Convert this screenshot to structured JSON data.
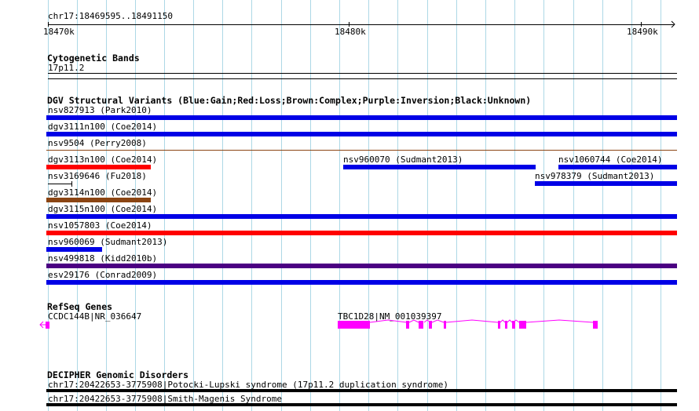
{
  "ruler": {
    "location": "chr17:18469595..18491150",
    "ticks": [
      "18470k",
      "18480k",
      "18490k"
    ]
  },
  "tracks": {
    "cytogenetic": {
      "title": "Cytogenetic Bands",
      "band_label": "17p11.2"
    },
    "dgv": {
      "title": "DGV Structural Variants (Blue:Gain;Red:Loss;Brown:Complex;Purple:Inversion;Black:Unknown)",
      "colors": {
        "gain": "#0000e6",
        "loss": "#ff0000",
        "complex": "#8b4513",
        "inversion": "#4b0082",
        "unknown": "#000000"
      },
      "features": [
        {
          "label": "nsv827913 (Park2010)",
          "type": "gain"
        },
        {
          "label": "dgv3111n100 (Coe2014)",
          "type": "gain"
        },
        {
          "label": "nsv9504 (Perry2008)",
          "type": "complex"
        },
        {
          "label": "dgv3113n100 (Coe2014)",
          "type": "loss"
        },
        {
          "label": "nsv960070 (Sudmant2013)",
          "type": "gain"
        },
        {
          "label": "nsv1060744 (Coe2014)",
          "type": "gain"
        },
        {
          "label": "nsv3169646 (Fu2018)",
          "type": "unknown"
        },
        {
          "label": "nsv978379 (Sudmant2013)",
          "type": "gain"
        },
        {
          "label": "dgv3114n100 (Coe2014)",
          "type": "complex"
        },
        {
          "label": "dgv3115n100 (Coe2014)",
          "type": "gain"
        },
        {
          "label": "nsv1057803 (Coe2014)",
          "type": "loss"
        },
        {
          "label": "nsv960069 (Sudmant2013)",
          "type": "gain"
        },
        {
          "label": "nsv499818 (Kidd2010b)",
          "type": "inversion"
        },
        {
          "label": "esv29176 (Conrad2009)",
          "type": "gain"
        }
      ]
    },
    "refseq": {
      "title": "RefSeq Genes",
      "color": "#ff00ff",
      "genes": [
        {
          "label": "CCDC144B|NR_036647",
          "strand": "-"
        },
        {
          "label": "TBC1D28|NM_001039397",
          "strand": "-"
        }
      ]
    },
    "decipher": {
      "title": "DECIPHER Genomic Disorders",
      "features": [
        {
          "label": "chr17:20422653-3775908|Potocki-Lupski syndrome (17p11.2 duplication syndrome)"
        },
        {
          "label": "chr17:20422653-3775908|Smith-Magenis Syndrome"
        }
      ]
    }
  }
}
